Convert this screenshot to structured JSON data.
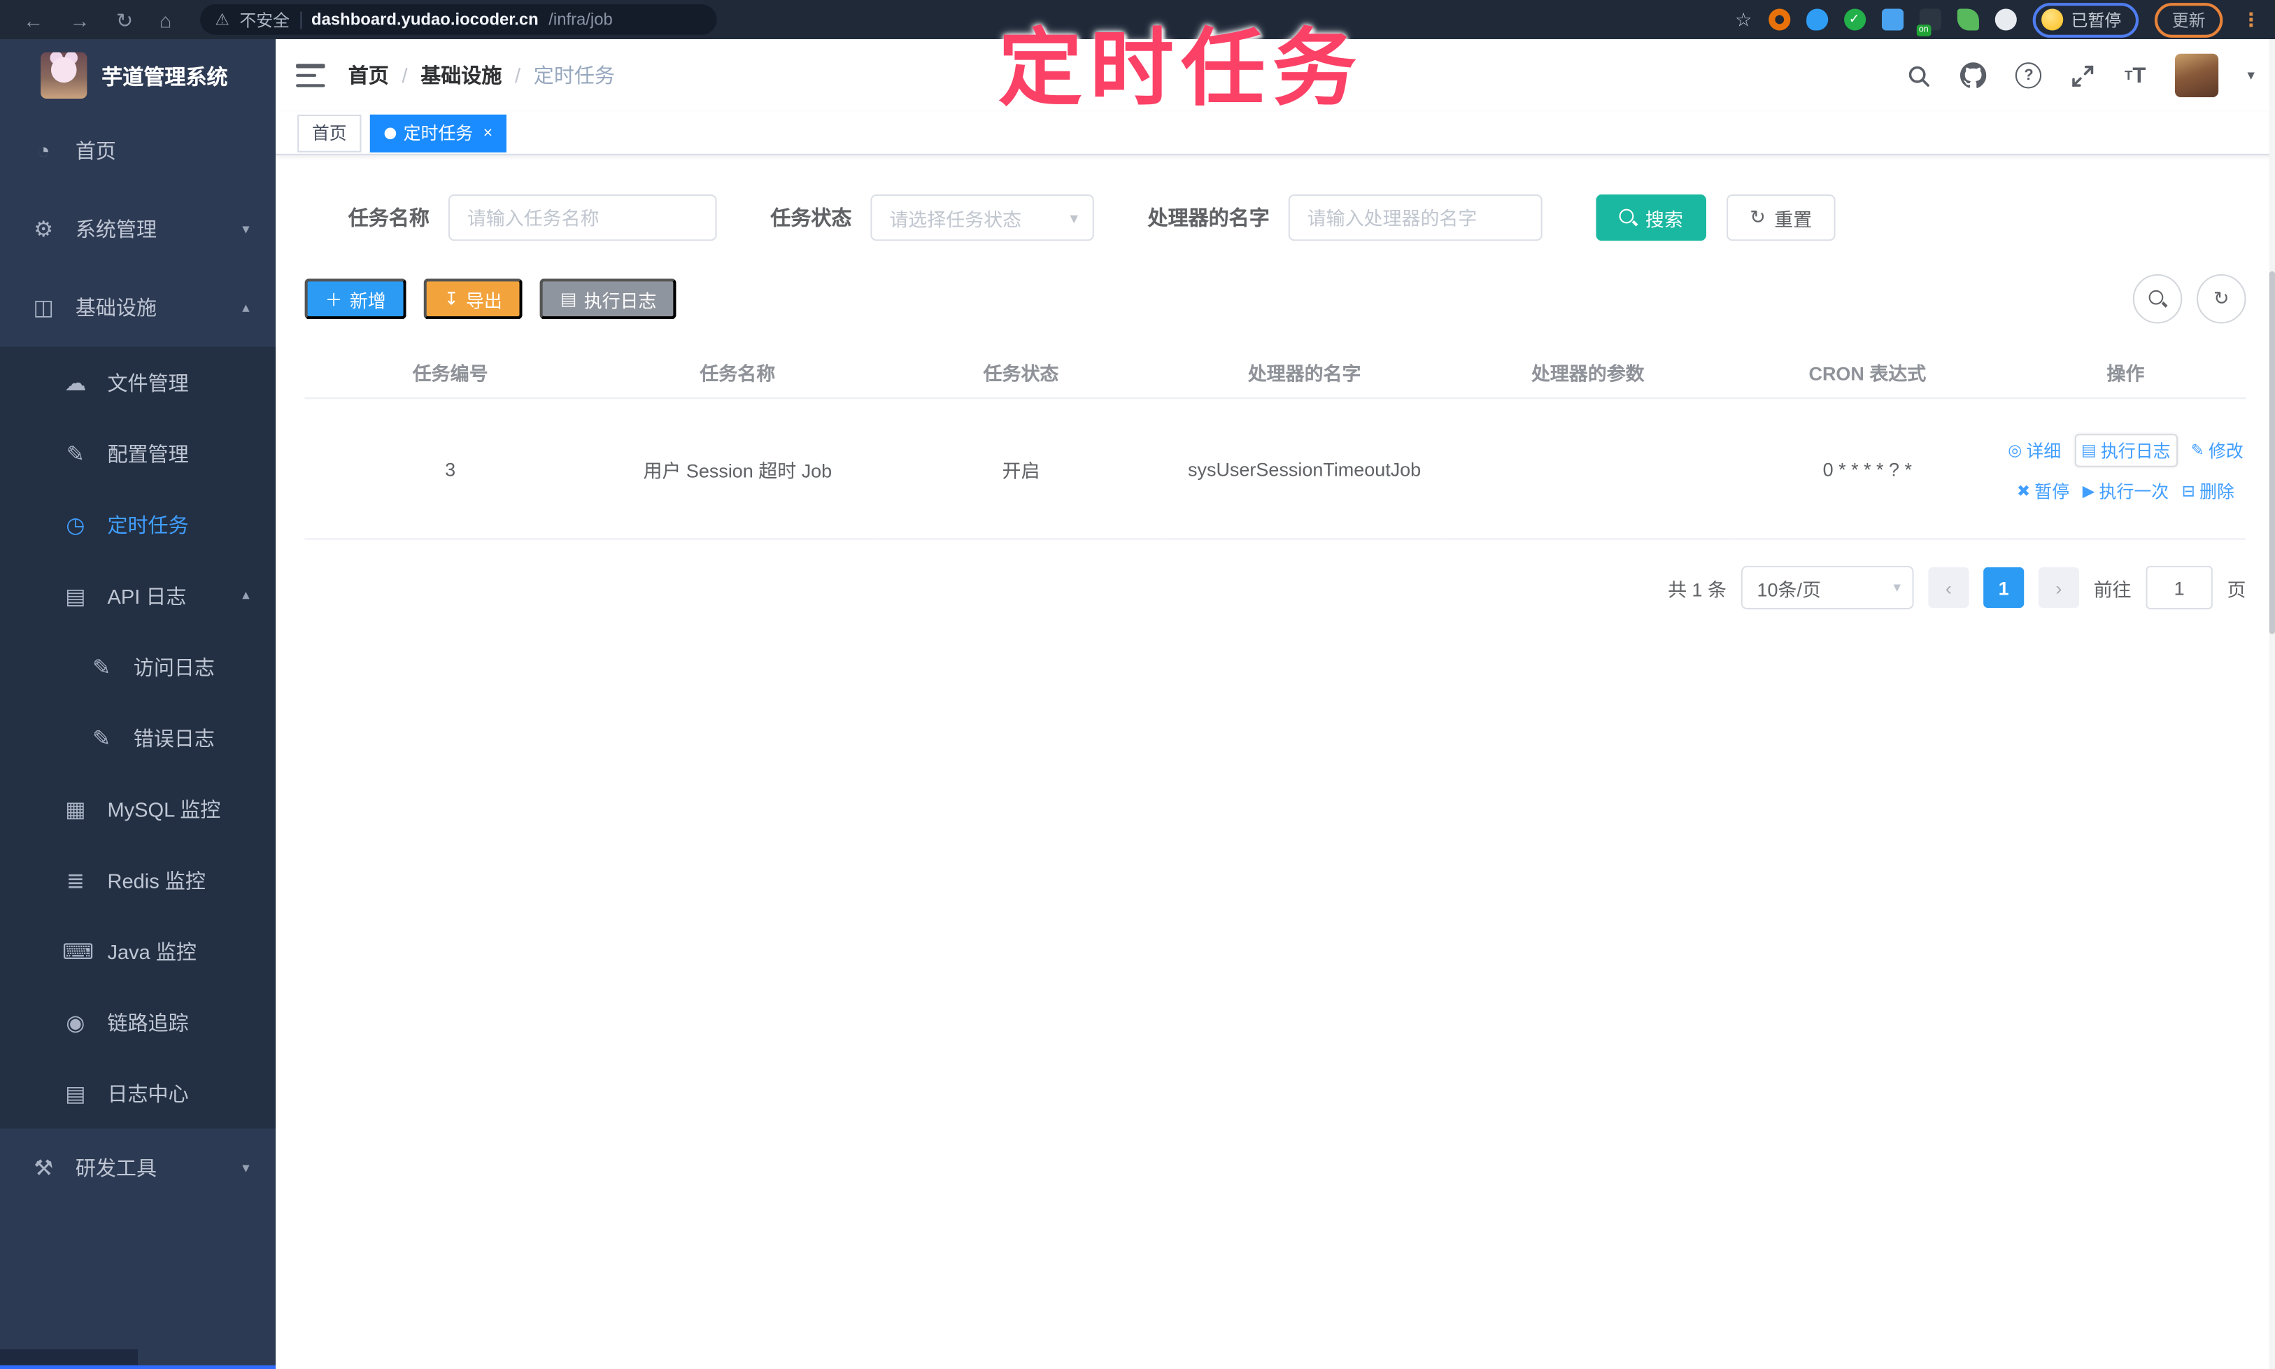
{
  "browser": {
    "security_label": "不安全",
    "url_host": "dashboard.yudao.iocoder.cn",
    "url_path": "/infra/job",
    "extension_on_badge": "on",
    "paused_label": "已暂停",
    "update_label": "更新"
  },
  "annotation": {
    "title": "定时任务"
  },
  "glyphs": {
    "back": "←",
    "forward": "→",
    "reload": "↻",
    "home": "⌂",
    "warning": "⚠",
    "star": "☆",
    "dots": "⋮",
    "check": "✓",
    "dashboard": "◔",
    "gear": "⚙",
    "infra": "◫",
    "cloud": "☁",
    "edit": "✎",
    "timer": "◷",
    "apilog": "▤",
    "doc": "✎",
    "mysql": "▦",
    "redis": "≣",
    "java": "⌨",
    "eye": "◉",
    "logcenter": "▤",
    "tools": "⚒",
    "chev_down": "▾",
    "chev_up": "▴",
    "caret": "▾",
    "question": "?",
    "plus": "＋",
    "download": "↧",
    "list": "▤",
    "refresh": "↻",
    "detail": "◎",
    "pause": "✖",
    "play": "▶",
    "trash": "⊟"
  },
  "sidebar": {
    "logo_title": "芋道管理系统",
    "items": [
      {
        "label": "首页",
        "icon": "dashboard-icon",
        "level": 1
      },
      {
        "label": "系统管理",
        "icon": "gear-icon",
        "level": 1,
        "state": "collapsed"
      },
      {
        "label": "基础设施",
        "icon": "infrastructure-icon",
        "level": 1,
        "state": "expanded"
      },
      {
        "label": "文件管理",
        "icon": "cloud-upload-icon",
        "level": 2
      },
      {
        "label": "配置管理",
        "icon": "config-edit-icon",
        "level": 2
      },
      {
        "label": "定时任务",
        "icon": "timer-icon",
        "level": 2,
        "active": true
      },
      {
        "label": "API 日志",
        "icon": "api-log-icon",
        "level": 2,
        "state": "expanded"
      },
      {
        "label": "访问日志",
        "icon": "access-log-icon",
        "level": 3
      },
      {
        "label": "错误日志",
        "icon": "error-log-icon",
        "level": 3
      },
      {
        "label": "MySQL 监控",
        "icon": "mysql-monitor-icon",
        "level": 2
      },
      {
        "label": "Redis 监控",
        "icon": "redis-monitor-icon",
        "level": 2
      },
      {
        "label": "Java 监控",
        "icon": "java-monitor-icon",
        "level": 2
      },
      {
        "label": "链路追踪",
        "icon": "trace-icon",
        "level": 2
      },
      {
        "label": "日志中心",
        "icon": "log-center-icon",
        "level": 2
      },
      {
        "label": "研发工具",
        "icon": "dev-tools-icon",
        "level": 1,
        "state": "collapsed"
      }
    ]
  },
  "breadcrumb": {
    "separator": "/",
    "items": [
      "首页",
      "基础设施",
      "定时任务"
    ]
  },
  "tags": {
    "close_glyph": "×",
    "items": [
      {
        "label": "首页",
        "active": false
      },
      {
        "label": "定时任务",
        "active": true,
        "closable": true
      }
    ]
  },
  "filters": {
    "name_label": "任务名称",
    "name_placeholder": "请输入任务名称",
    "status_label": "任务状态",
    "status_placeholder": "请选择任务状态",
    "handler_label": "处理器的名字",
    "handler_placeholder": "请输入处理器的名字",
    "search_label": "搜索",
    "reset_label": "重置"
  },
  "toolbar": {
    "add_label": "新增",
    "export_label": "导出",
    "exec_log_label": "执行日志"
  },
  "table": {
    "headers": [
      "任务编号",
      "任务名称",
      "任务状态",
      "处理器的名字",
      "处理器的参数",
      "CRON 表达式",
      "操作"
    ],
    "rows": [
      {
        "id": "3",
        "name": "用户 Session 超时 Job",
        "status": "开启",
        "handler": "sysUserSessionTimeoutJob",
        "params": "",
        "cron": "0 * * * * ? *",
        "actions": [
          {
            "label": "详细"
          },
          {
            "label": "执行日志"
          },
          {
            "label": "修改"
          },
          {
            "label": "暂停"
          },
          {
            "label": "执行一次"
          },
          {
            "label": "删除"
          }
        ]
      }
    ]
  },
  "pagination": {
    "total": "共 1 条",
    "page_size": "10条/页",
    "prev": "‹",
    "page": "1",
    "next": "›",
    "goto_label": "前往",
    "goto_value": "1",
    "unit_label": "页"
  }
}
